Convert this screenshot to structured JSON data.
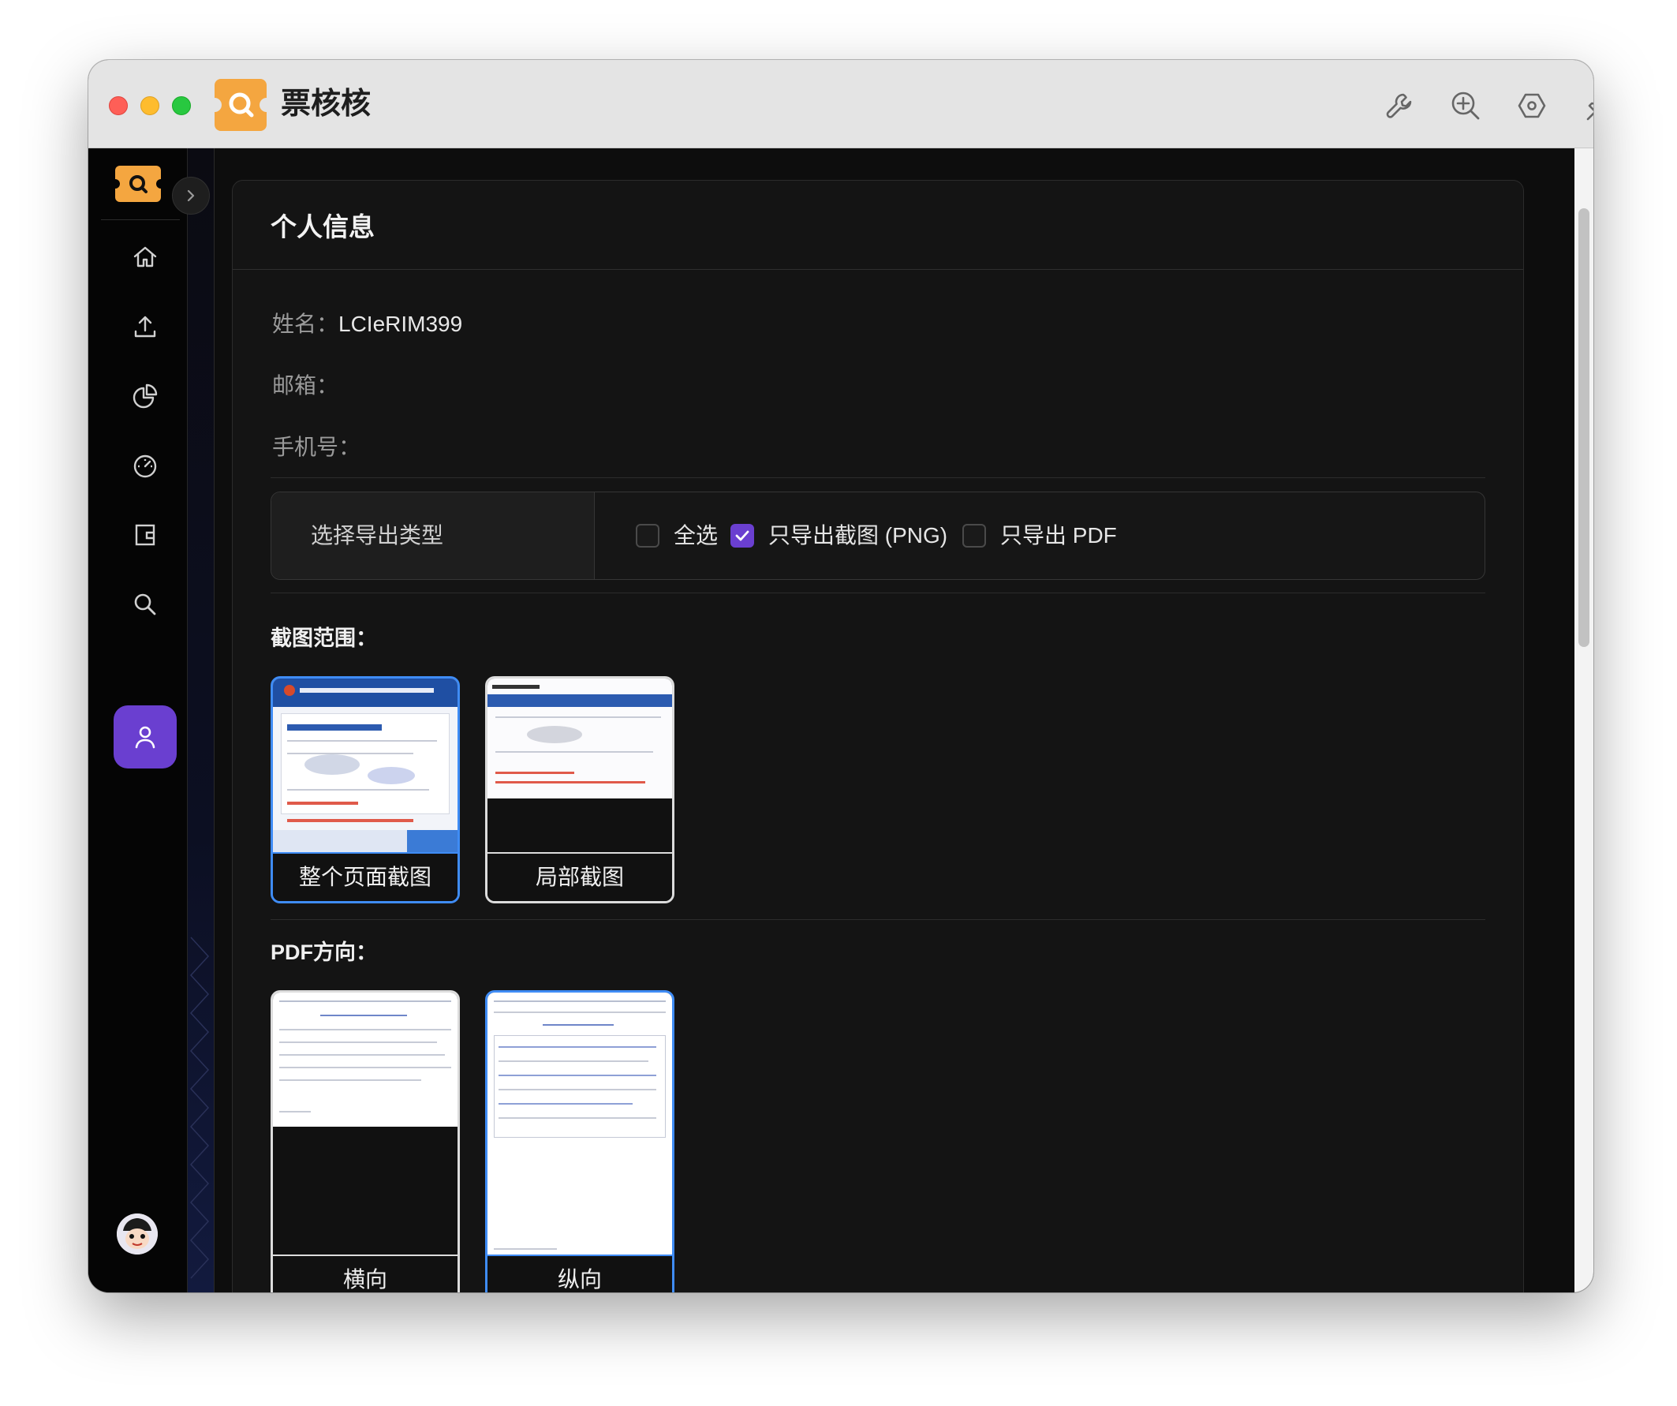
{
  "window": {
    "title": "票核核"
  },
  "toolbar": {
    "icons": [
      "wrench-icon",
      "zoom-in-icon",
      "hexagon-settings-icon",
      "pin-icon"
    ]
  },
  "sidebar": {
    "items": [
      {
        "name": "home",
        "icon": "home-icon"
      },
      {
        "name": "upload",
        "icon": "upload-icon"
      },
      {
        "name": "statistics",
        "icon": "pie-chart-icon"
      },
      {
        "name": "dashboard",
        "icon": "speedometer-icon"
      },
      {
        "name": "wallet",
        "icon": "wallet-icon"
      },
      {
        "name": "search",
        "icon": "search-icon"
      },
      {
        "name": "profile",
        "icon": "user-icon",
        "active": true
      }
    ]
  },
  "card": {
    "title": "个人信息",
    "name_label": "姓名：",
    "name_value": "LCIeRIM399",
    "email_label": "邮箱：",
    "email_value": "",
    "phone_label": "手机号：",
    "phone_value": ""
  },
  "export": {
    "label": "选择导出类型",
    "options": [
      {
        "label": "全选",
        "checked": false
      },
      {
        "label": "只导出截图 (PNG)",
        "checked": true
      },
      {
        "label": "只导出 PDF",
        "checked": false
      }
    ]
  },
  "screenshot_range": {
    "title": "截图范围：",
    "options": [
      {
        "label": "整个页面截图",
        "selected": true
      },
      {
        "label": "局部截图",
        "selected": false
      }
    ]
  },
  "pdf_orientation": {
    "title": "PDF方向：",
    "options": [
      {
        "label": "横向",
        "selected": false
      },
      {
        "label": "纵向",
        "selected": true
      }
    ]
  },
  "colors": {
    "accent": "#6a3fd0",
    "selected_border": "#3f8cf5",
    "logo": "#f4a640"
  }
}
